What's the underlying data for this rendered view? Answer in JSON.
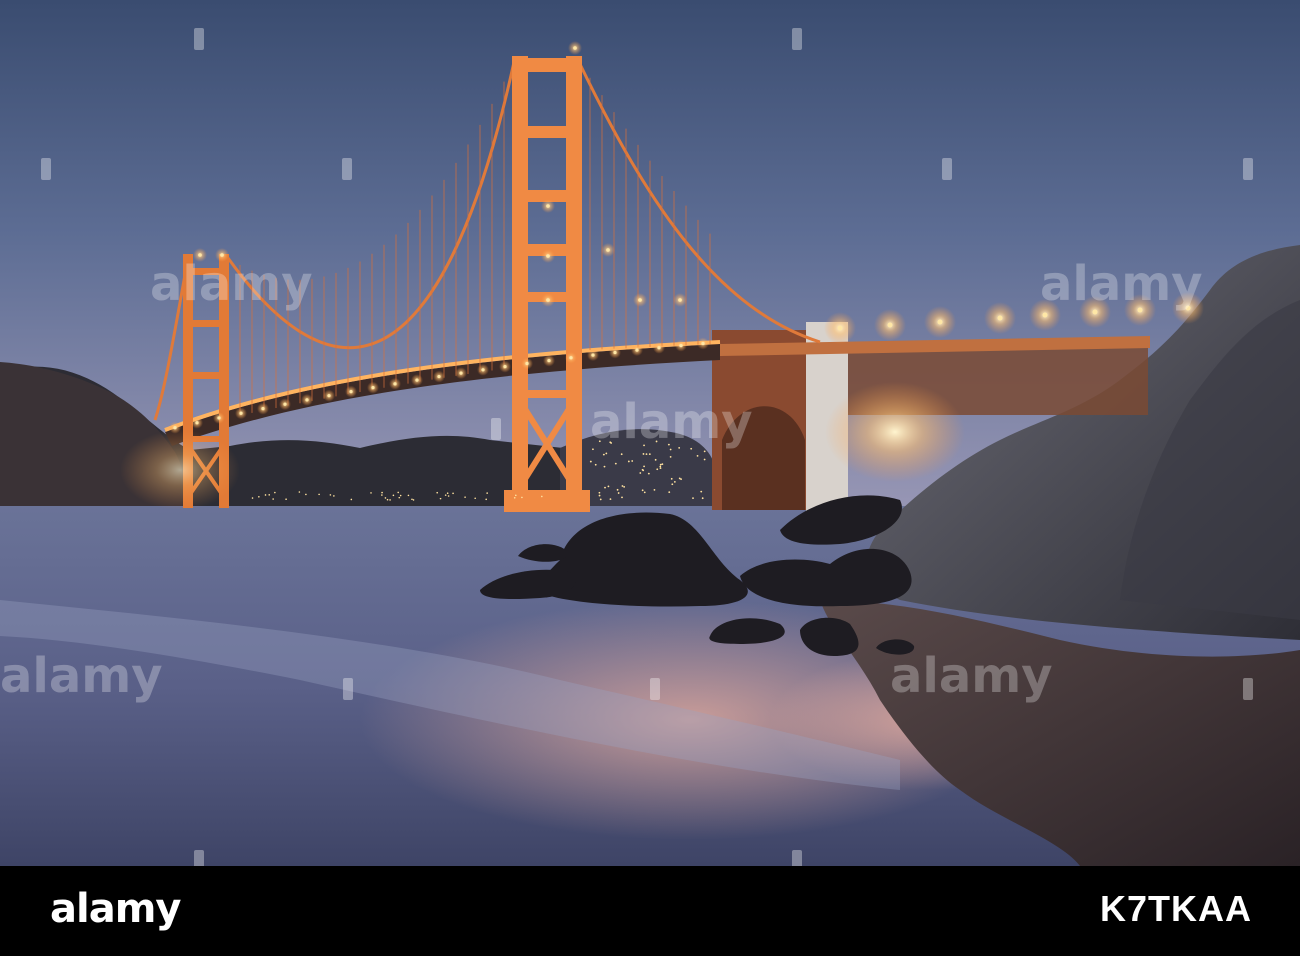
{
  "watermark": {
    "text": "alamy"
  },
  "footer": {
    "brand": "alamy",
    "image_id": "K7TKAA"
  },
  "colors": {
    "sky_top": "#3c4f72",
    "sky_bottom": "#8a90b4",
    "bridge": "#e0752c",
    "lights": "#ffe7a6",
    "footer_bg": "#000000"
  }
}
